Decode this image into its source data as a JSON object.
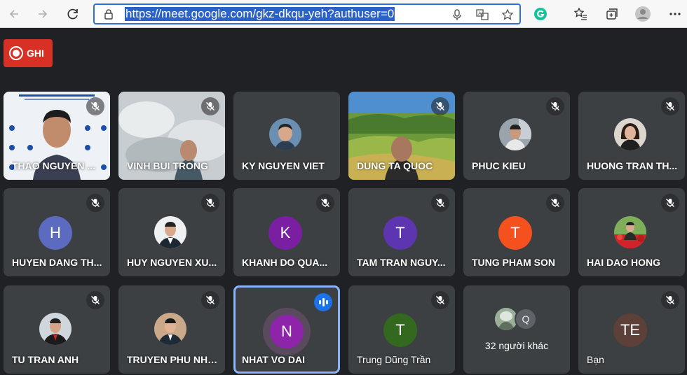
{
  "browser": {
    "url": "https://meet.google.com/gkz-dkqu-yeh?authuser=0",
    "icons": [
      "back-icon",
      "forward-icon",
      "refresh-icon",
      "lock-icon",
      "mic-icon",
      "translate-icon",
      "star-icon",
      "grammarly-icon",
      "favorites-icon",
      "collections-icon",
      "profile-icon",
      "more-icon"
    ]
  },
  "record": {
    "label": "GHI",
    "color": "#d93025"
  },
  "tiles": [
    {
      "name": "THAO NGUYEN ...",
      "muted": true,
      "kind": "video"
    },
    {
      "name": "VINH BUI TRONG",
      "muted": true,
      "kind": "video"
    },
    {
      "name": "KY NGUYEN VIET",
      "muted": false,
      "kind": "photo"
    },
    {
      "name": "DUNG TA QUOC",
      "muted": true,
      "kind": "video"
    },
    {
      "name": "PHUC KIEU",
      "muted": true,
      "kind": "photo"
    },
    {
      "name": "HUONG TRAN TH...",
      "muted": true,
      "kind": "photo"
    },
    {
      "name": "HUYEN DANG TH...",
      "muted": true,
      "kind": "letter",
      "letter": "H",
      "color": "#5c6bc0"
    },
    {
      "name": "HUY NGUYEN XU...",
      "muted": true,
      "kind": "photo"
    },
    {
      "name": "KHANH DO QUA...",
      "muted": true,
      "kind": "letter",
      "letter": "K",
      "color": "#7b1fa2"
    },
    {
      "name": "TAM TRAN NGUY...",
      "muted": true,
      "kind": "letter",
      "letter": "T",
      "color": "#5e35b1"
    },
    {
      "name": "TUNG PHAM SON",
      "muted": true,
      "kind": "letter",
      "letter": "T",
      "color": "#f4511e"
    },
    {
      "name": "HAI DAO HONG",
      "muted": true,
      "kind": "photo"
    },
    {
      "name": "TU TRAN ANH",
      "muted": true,
      "kind": "photo"
    },
    {
      "name": "TRUYEN PHU NHAT",
      "muted": true,
      "kind": "photo"
    },
    {
      "name": "NHAT VO DAI",
      "muted": false,
      "kind": "letter",
      "letter": "N",
      "color": "#8e24aa",
      "speaking": true
    },
    {
      "name": "Trung Dũng Trần",
      "muted": true,
      "kind": "letter",
      "letter": "T",
      "color": "#33691e"
    },
    {
      "name": "32 người khác",
      "kind": "more",
      "letter": "Q"
    },
    {
      "name": "Bạn",
      "muted": true,
      "kind": "letter",
      "letter": "TE",
      "color": "#5d4037"
    }
  ]
}
